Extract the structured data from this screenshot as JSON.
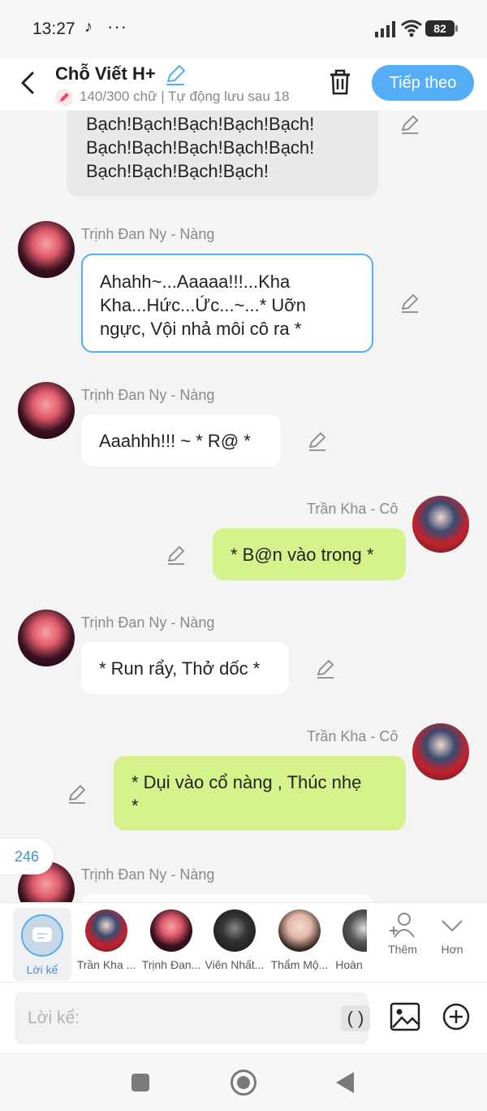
{
  "status_bar": {
    "time": "13:27",
    "battery": "82"
  },
  "header": {
    "title": "Chỗ Viết H+",
    "subtitle": "140/300 chữ | Tự động lưu sau 18",
    "next_label": "Tiếp theo"
  },
  "chat": {
    "messages": [
      {
        "side": "left",
        "sender": "",
        "text": "Bạch!Bạch!Bạch!Bạch!Bạch!\nBạch!Bạch!Bạch!Bạch!Bạch!\nBạch!Bạch!Bạch!Bạch!"
      },
      {
        "side": "left",
        "sender": "Trịnh Đan Ny - Nàng",
        "text": "Ahahh~...Aaaaa!!!...Kha\nKha...Hức...Ức...~...* Uỡn\nngực, Vội nhả môi cô ra *"
      },
      {
        "side": "left",
        "sender": "Trịnh Đan Ny - Nàng",
        "text": "Aaahhh!!! ~ * R@ *"
      },
      {
        "side": "right",
        "sender": "Trần Kha - Cô",
        "text": "* B@n vào trong *"
      },
      {
        "side": "left",
        "sender": "Trịnh Đan Ny - Nàng",
        "text": "* Run rẩy, Thở dốc *"
      },
      {
        "side": "right",
        "sender": "Trần Kha - Cô",
        "text": "* Dụi vào cổ nàng , Thúc nhẹ\n*"
      },
      {
        "side": "left",
        "sender": "Trịnh Đan Ny - Nàng",
        "text": ""
      }
    ],
    "counter": "246"
  },
  "characters": {
    "items": [
      {
        "label": "Lời kể",
        "active": true
      },
      {
        "label": "Trần Kha ...",
        "active": false
      },
      {
        "label": "Trịnh Đan...",
        "active": false
      },
      {
        "label": "Viên Nhất...",
        "active": false
      },
      {
        "label": "Thẩm Mộ...",
        "active": false
      },
      {
        "label": "Hoàn",
        "active": false
      }
    ],
    "add_label": "Thêm",
    "more_label": "Hơn"
  },
  "input": {
    "placeholder": "Lời kể:",
    "paren_label": "( )"
  },
  "colors": {
    "accent": "#55aef5",
    "green_bubble": "#d6f28a",
    "white_bubble": "#ffffff"
  },
  "icons": [
    "back-icon",
    "edit-pencil-icon",
    "trash-icon",
    "image-icon",
    "plus-circle-icon",
    "person-add-icon",
    "chevron-down-icon",
    "speech-icon"
  ]
}
